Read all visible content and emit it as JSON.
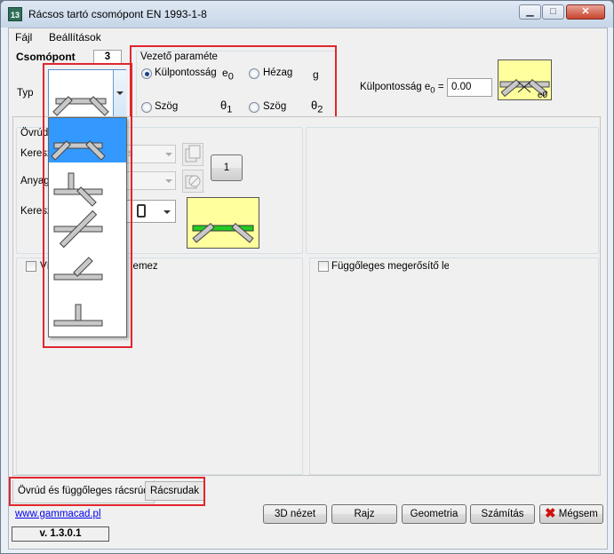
{
  "window": {
    "title": "Rácsos tartó csomópont EN 1993-1-8",
    "app_icon_text": "13"
  },
  "menu": {
    "file": "Fájl",
    "settings": "Beállítások"
  },
  "node": {
    "label": "Csomópont",
    "value": "3"
  },
  "type": {
    "label": "Typ"
  },
  "lead_param": {
    "title": "Vezető paraméte",
    "eccentricity": "Külpontosság",
    "gap": "Hézag",
    "angle1": "Szög",
    "angle2": "Szög",
    "sym_e0": "e",
    "sym_e0_sub": "0",
    "sym_g": "g",
    "sym_theta1": "θ",
    "sym_theta1_sub": "1",
    "sym_theta2": "θ",
    "sym_theta2_sub": "2",
    "selected": "Külpontosság"
  },
  "eccentricity_field": {
    "label": "Külpontosság  e",
    "label_sub": "0",
    "label_eq": "=",
    "value": "0.00"
  },
  "chord_panel": {
    "title": "Övrúd",
    "cross_section": "Kereszt",
    "material": "Anyag",
    "cross_section2": "Keresz",
    "count_button": "1"
  },
  "stiffener_left": {
    "label": "Vízszintes megerősítő lemez",
    "visible_label": "Ví",
    "visible_label_tail": "lemez"
  },
  "stiffener_right": {
    "label": "Függőleges megerősítő lemez"
  },
  "tabs": [
    {
      "label": "Övrúd és függőleges rácsrúd"
    },
    {
      "label": "Rácsrudak"
    }
  ],
  "website": "www.gammacad.pl",
  "version": "v. 1.3.0.1",
  "buttons": {
    "view3d": "3D nézet",
    "draw": "Rajz",
    "geometry": "Geometria",
    "calc": "Számítás",
    "cancel": "Mégsem"
  },
  "dropdown_items": [
    {
      "name": "k-joint",
      "selected": true
    },
    {
      "name": "n-joint-vertical",
      "selected": false
    },
    {
      "name": "cross-joint",
      "selected": false
    },
    {
      "name": "y-joint",
      "selected": false
    },
    {
      "name": "t-joint",
      "selected": false
    }
  ],
  "colors": {
    "highlight": "#3399ff",
    "red_outline": "#e0262e",
    "preview_bg": "#ffff9d",
    "chord_green": "#22cc22"
  }
}
